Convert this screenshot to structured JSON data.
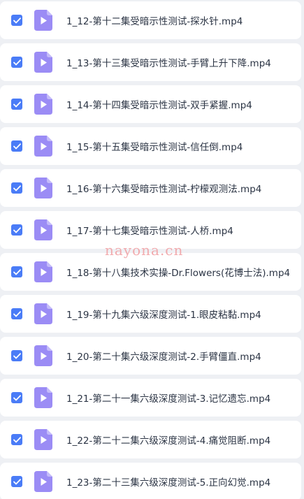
{
  "files": [
    {
      "name": "1_12-第十二集受暗示性测试-探水针.mp4",
      "checked": true
    },
    {
      "name": "1_13-第十三集受暗示性测试-手臂上升下降.mp4",
      "checked": true
    },
    {
      "name": "1_14-第十四集受暗示性测试-双手紧握.mp4",
      "checked": true
    },
    {
      "name": "1_15-第十五集受暗示性测试-信任倒.mp4",
      "checked": true
    },
    {
      "name": "1_16-第十六集受暗示性测试-柠檬观测法.mp4",
      "checked": true
    },
    {
      "name": "1_17-第十七集受暗示性测试-人桥.mp4",
      "checked": true
    },
    {
      "name": "1_18-第十八集技术实操-Dr.Flowers(花博士法).mp4",
      "checked": true
    },
    {
      "name": "1_19-第十九集六级深度测试-1.眼皮粘黏.mp4",
      "checked": true
    },
    {
      "name": "1_20-第二十集六级深度测试-2.手臂僵直.mp4",
      "checked": true
    },
    {
      "name": "1_21-第二十一集六级深度测试-3.记忆遗忘.mp4",
      "checked": true
    },
    {
      "name": "1_22-第二十二集六级深度测试-4.痛觉阻断.mp4",
      "checked": true
    },
    {
      "name": "1_23-第二十三集六级深度测试-5.正向幻觉.mp4",
      "checked": true
    }
  ],
  "watermark": "nayona.cn",
  "colors": {
    "checkbox": "#4a7cf7",
    "file_icon": "#9b8cf5",
    "row_background": "#ffffff",
    "page_background": "#eef0f4",
    "watermark": "#f1a3a6"
  },
  "icons": {
    "checkbox": "checkmark-icon",
    "file": "video-file-play-icon"
  }
}
